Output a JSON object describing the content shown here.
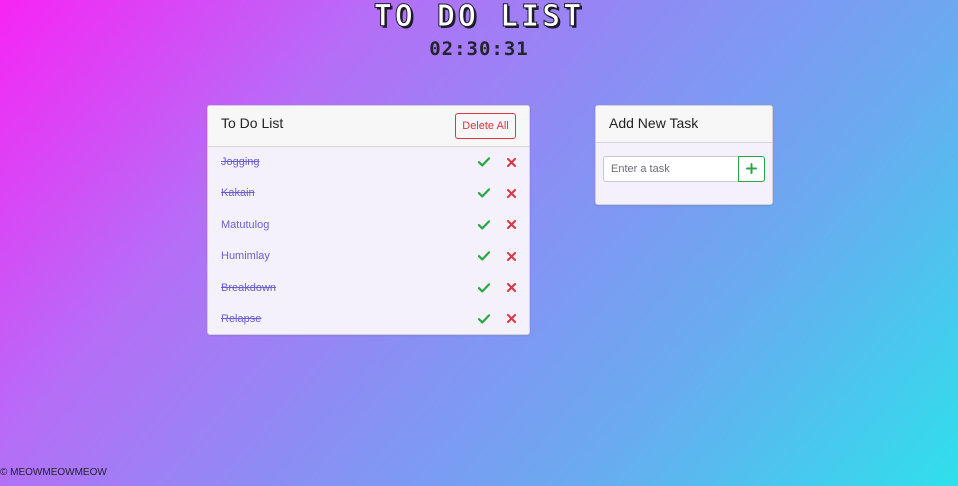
{
  "app": {
    "title": "TO DO LIST",
    "clock": "02:30:31"
  },
  "todo_card": {
    "title": "To Do List",
    "delete_all_label": "Delete All",
    "tasks": [
      {
        "label": "Jogging",
        "completed": true
      },
      {
        "label": "Kakain",
        "completed": true
      },
      {
        "label": "Matutulog",
        "completed": false
      },
      {
        "label": "Humimlay",
        "completed": false
      },
      {
        "label": "Breakdown",
        "completed": true
      },
      {
        "label": "Relapse",
        "completed": true
      }
    ],
    "check_icon": "check-icon",
    "delete_icon": "close-icon"
  },
  "add_card": {
    "title": "Add New Task",
    "input_value": "",
    "input_placeholder": "Enter a task",
    "add_icon": "plus-icon"
  },
  "footer": {
    "text": "© MEOWMEOWMEOW"
  },
  "colors": {
    "gradient_start": "#f824f5",
    "gradient_end": "#2ee0ec",
    "task_text": "#6b5fd0",
    "success": "#28a745",
    "danger": "#dc3545"
  }
}
